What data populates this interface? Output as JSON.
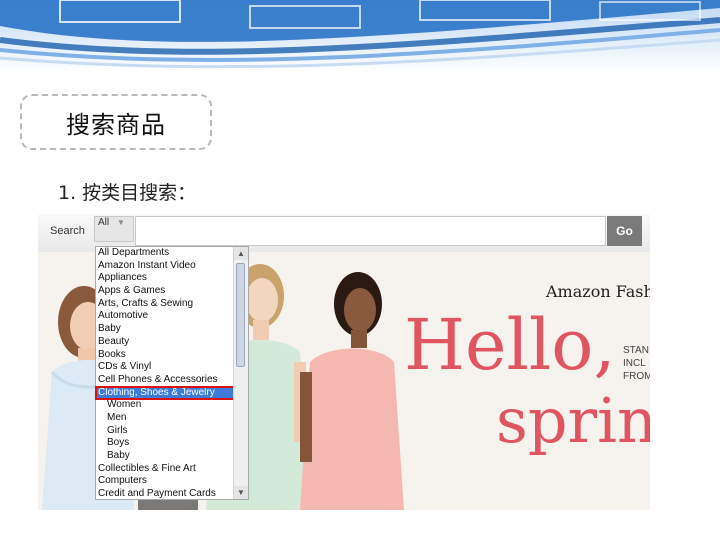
{
  "slide": {
    "title": "搜索商品",
    "step": "1. 按类目搜索："
  },
  "search": {
    "label": "Search",
    "category_value": "All",
    "go_label": "Go"
  },
  "dropdown": {
    "items": [
      {
        "label": "All Departments",
        "sub": false
      },
      {
        "label": "Amazon Instant Video",
        "sub": false
      },
      {
        "label": "Appliances",
        "sub": false
      },
      {
        "label": "Apps & Games",
        "sub": false
      },
      {
        "label": "Arts, Crafts & Sewing",
        "sub": false
      },
      {
        "label": "Automotive",
        "sub": false
      },
      {
        "label": "Baby",
        "sub": false
      },
      {
        "label": "Beauty",
        "sub": false
      },
      {
        "label": "Books",
        "sub": false
      },
      {
        "label": "CDs & Vinyl",
        "sub": false
      },
      {
        "label": "Cell Phones & Accessories",
        "sub": false
      },
      {
        "label": "Clothing, Shoes & Jewelry",
        "sub": false,
        "selected": true
      },
      {
        "label": "Women",
        "sub": true
      },
      {
        "label": "Men",
        "sub": true
      },
      {
        "label": "Girls",
        "sub": true
      },
      {
        "label": "Boys",
        "sub": true
      },
      {
        "label": "Baby",
        "sub": true
      },
      {
        "label": "Collectibles & Fine Art",
        "sub": false
      },
      {
        "label": "Computers",
        "sub": false
      },
      {
        "label": "Credit and Payment Cards",
        "sub": false
      }
    ]
  },
  "hero": {
    "brand": "Amazon Fash",
    "headline_1": "Hello,",
    "headline_2": "sprin",
    "side_lines": [
      "STAN",
      "INCL",
      "FROM"
    ]
  },
  "colors": {
    "accent_red": "#e05660",
    "banner_blue": "#2a74c8",
    "selection_blue": "#3d7bd8",
    "highlight_border": "#dd1111"
  }
}
